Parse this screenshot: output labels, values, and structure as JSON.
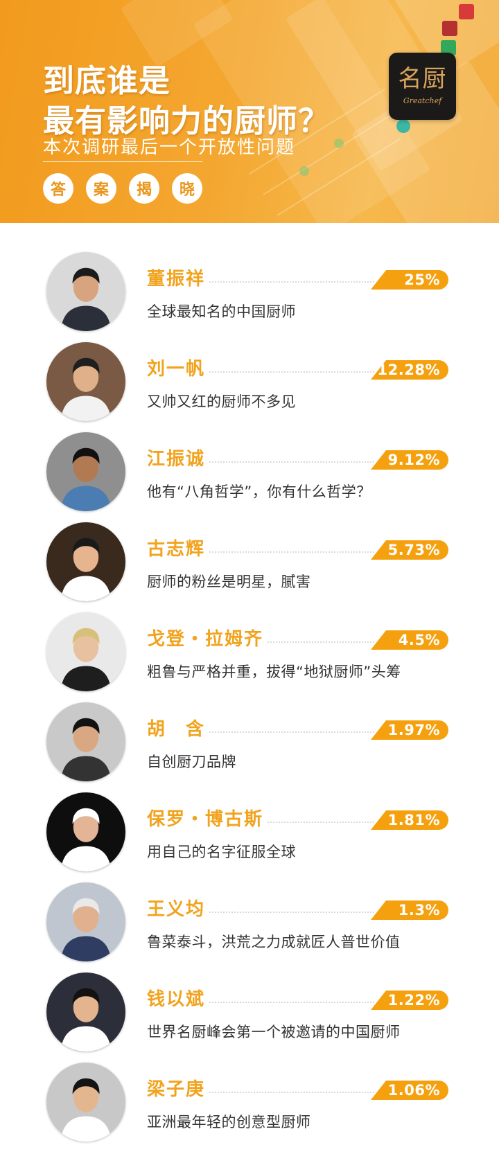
{
  "header": {
    "title_line1": "到底谁是",
    "title_line2": "最有影响力的厨师？",
    "subtitle": "本次调研最后一个开放性问题",
    "answer_chips": [
      "答",
      "案",
      "揭",
      "晓"
    ],
    "logo": {
      "cn": "名厨",
      "en": "Greatchef"
    }
  },
  "colors": {
    "accent": "#f5a10f",
    "name_text": "#f1a31d",
    "banner_start": "#f29a1d",
    "banner_end": "#f6b84c",
    "logo_bg": "#1c1a18"
  },
  "chefs": [
    {
      "rank": 1,
      "name": "董振祥",
      "percent": "25%",
      "description": "全球最知名的中国厨师",
      "avatar_icon": "chef-portrait-suit"
    },
    {
      "rank": 2,
      "name": "刘一帆",
      "percent": "12.28%",
      "description": "又帅又红的厨师不多见",
      "avatar_icon": "chef-portrait-glasses"
    },
    {
      "rank": 3,
      "name": "江振诚",
      "percent": "9.12%",
      "description": "他有“八角哲学”，你有什么哲学？",
      "avatar_icon": "chef-portrait-shirt"
    },
    {
      "rank": 4,
      "name": "古志辉",
      "percent": "5.73%",
      "description": "厨师的粉丝是明星，腻害",
      "avatar_icon": "chef-portrait-whites"
    },
    {
      "rank": 5,
      "name": "戈登・拉姆齐",
      "percent": "4.5%",
      "description": "粗鲁与严格并重，拔得“地狱厨师”头筹",
      "avatar_icon": "chef-portrait-blond"
    },
    {
      "rank": 6,
      "name": "胡　含",
      "percent": "1.97%",
      "description": "自创厨刀品牌",
      "avatar_icon": "chef-portrait-knife"
    },
    {
      "rank": 7,
      "name": "保罗・博古斯",
      "percent": "1.81%",
      "description": "用自己的名字征服全球",
      "avatar_icon": "chef-portrait-toque"
    },
    {
      "rank": 8,
      "name": "王义均",
      "percent": "1.3%",
      "description": "鲁菜泰斗，洪荒之力成就匠人普世价值",
      "avatar_icon": "chef-portrait-elder"
    },
    {
      "rank": 9,
      "name": "钱以斌",
      "percent": "1.22%",
      "description": "世界名厨峰会第一个被邀请的中国厨师",
      "avatar_icon": "chef-portrait-kitchen"
    },
    {
      "rank": 10,
      "name": "梁子庚",
      "percent": "1.06%",
      "description": "亚洲最年轻的创意型厨师",
      "avatar_icon": "chef-portrait-young"
    }
  ]
}
